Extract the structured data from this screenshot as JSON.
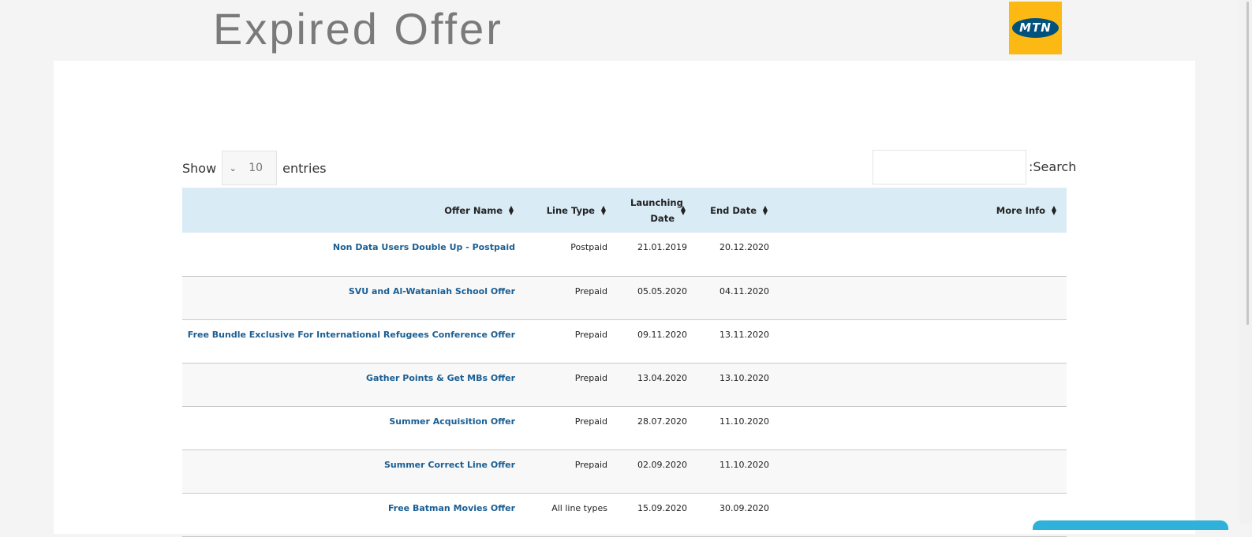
{
  "header": {
    "title": "Expired Offer",
    "logo_text": "MTN",
    "logo_color": "#fdb913"
  },
  "table_controls": {
    "show_label": "Show",
    "page_length": "10",
    "entries_label": "entries",
    "search_label": ":Search",
    "search_value": ""
  },
  "table": {
    "columns": {
      "offer_name": "Offer Name",
      "line_type": "Line Type",
      "launching_date_line1": "Launching",
      "launching_date_line2": "Date",
      "end_date": "End Date",
      "more_info": "More Info"
    },
    "rows": [
      {
        "name": "Non Data Users Double Up - Postpaid",
        "line_type": "Postpaid",
        "launch": "21.01.2019",
        "end": "20.12.2020",
        "more": ""
      },
      {
        "name": "SVU and Al-Wataniah School Offer",
        "line_type": "Prepaid",
        "launch": "05.05.2020",
        "end": "04.11.2020",
        "more": ""
      },
      {
        "name": "Free Bundle Exclusive For International Refugees Conference Offer",
        "line_type": "Prepaid",
        "launch": "09.11.2020",
        "end": "13.11.2020",
        "more": ""
      },
      {
        "name": "Gather Points & Get MBs Offer",
        "line_type": "Prepaid",
        "launch": "13.04.2020",
        "end": "13.10.2020",
        "more": ""
      },
      {
        "name": "Summer Acquisition Offer",
        "line_type": "Prepaid",
        "launch": "28.07.2020",
        "end": "11.10.2020",
        "more": ""
      },
      {
        "name": "Summer Correct Line Offer",
        "line_type": "Prepaid",
        "launch": "02.09.2020",
        "end": "11.10.2020",
        "more": ""
      },
      {
        "name": "Free Batman Movies Offer",
        "line_type": "All line types",
        "launch": "15.09.2020",
        "end": "30.09.2020",
        "more": ""
      }
    ]
  },
  "colors": {
    "header_row": "#d9ebf5",
    "link": "#1a5e93",
    "chat_widget": "#2fb1d9"
  }
}
